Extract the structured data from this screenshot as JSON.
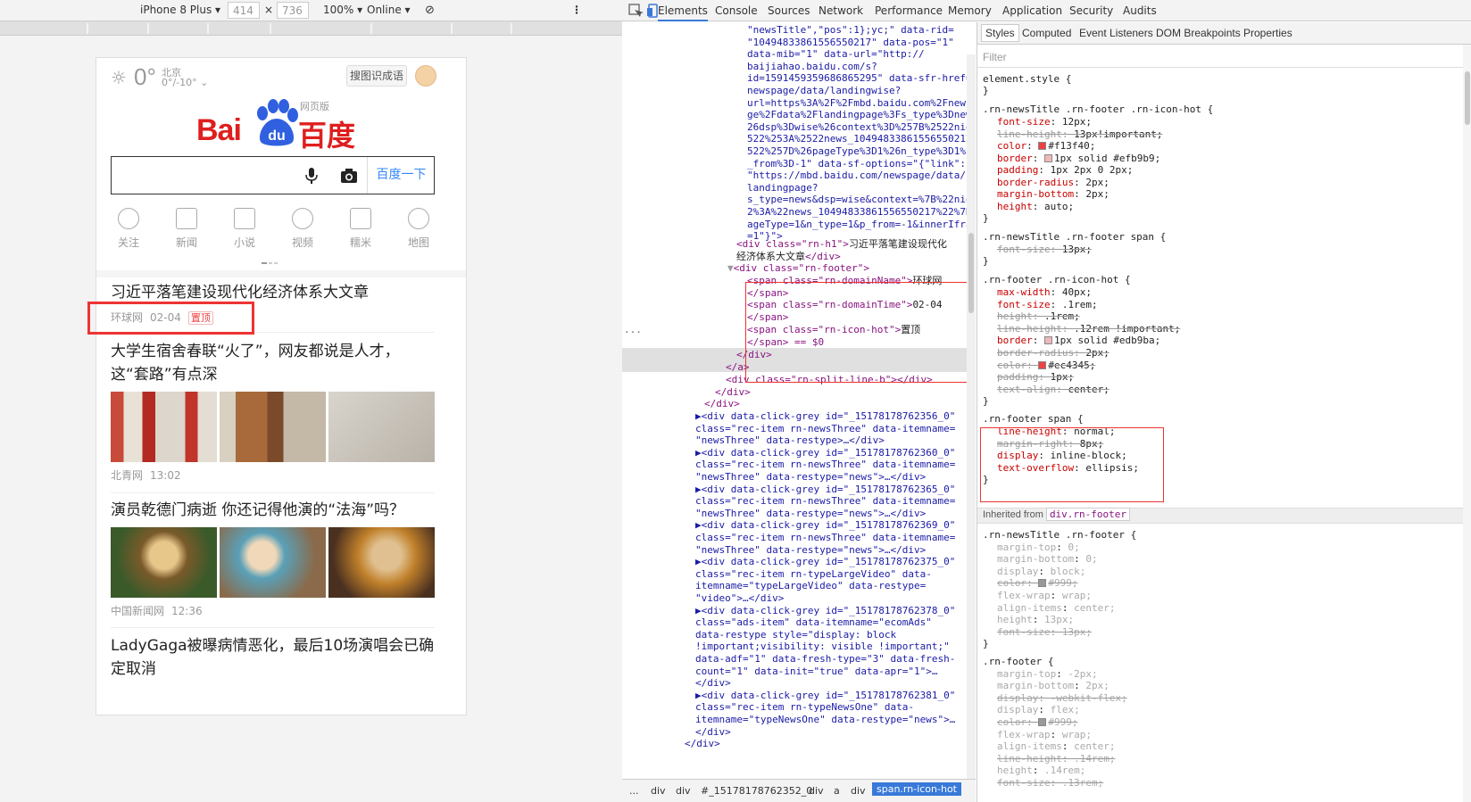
{
  "device": {
    "name": "iPhone 8 Plus",
    "width": "414",
    "height": "736",
    "times": "×",
    "zoom": "100%",
    "network": "Online"
  },
  "weather": {
    "temp": "0°",
    "city": "北京",
    "range": "0°/-10°"
  },
  "header": {
    "search_btn": "搜图识成语",
    "logo_text": "Bai",
    "logo_du": "du",
    "logo_cn": "百度",
    "logo_sub": "网页版",
    "search_button": "百度一下"
  },
  "nav": [
    "关注",
    "新闻",
    "小说",
    "视频",
    "糯米",
    "地图"
  ],
  "news": [
    {
      "title": "习近平落笔建设现代化经济体系大文章",
      "source": "环球网",
      "time": "02-04",
      "hot": "置顶"
    },
    {
      "title": "大学生宿舍春联“火了”，网友都说是人才，这“套路”有点深",
      "source": "北青网",
      "time": "13:02"
    },
    {
      "title": "演员乾德门病逝 你还记得他演的“法海”吗？",
      "source": "中国新闻网",
      "time": "12:36"
    },
    {
      "title": "LadyGaga被曝病情恶化，最后10场演唱会已确定取消"
    }
  ],
  "tabs": [
    "Elements",
    "Console",
    "Sources",
    "Network",
    "Performance",
    "Memory",
    "Application",
    "Security",
    "Audits"
  ],
  "elements": {
    "lines": [
      "\"newsTitle\",\"pos\":1};yc;\" data-rid=",
      "\"10494833861556550217\" data-pos=\"1\"",
      "data-mib=\"1\" data-url=\"http://",
      "baijiahao.baidu.com/s?",
      "id=1591459359686865295\" data-sfr-href=\"/",
      "newspage/data/landingwise?",
      "url=https%3A%2F%2Fmbd.baidu.com%2Fnewspa",
      "ge%2Fdata%2Flandingpage%3Fs_type%3Dnews%",
      "26dsp%3Dwise%26context%3D%257B%2522nid%2",
      "522%253A%2522news_10494833861556550217%2",
      "522%257D%26pageType%3D1%26n_type%3D1%26p",
      "_from%3D-1\" data-sf-options=\"{\"link\":",
      "\"https://mbd.baidu.com/newspage/data/",
      "landingpage?",
      "s_type=news&dsp=wise&context=%7B%22nid%2",
      "2%3A%22news_10494833861556550217%22%7D&p",
      "ageType=1&n_type=1&p_from=-1&innerIframe",
      "=1\"}\">"
    ],
    "h1": {
      "open": "<div class=\"rn-h1\">",
      "text": "习近平落笔建设现代化",
      "text2": "经济体系大文章",
      "close": "</div>"
    },
    "footer_open": "<div class=\"rn-footer\">",
    "span1_open": "<span class=\"rn-domainName\">",
    "span1_text": "环球网",
    "span2_open": "<span class=\"rn-domainTime\">",
    "span2_text": "02-04",
    "span3_open": "<span class=\"rn-icon-hot\">",
    "span3_text": "置顶",
    "span_close": "</span>",
    "span_sel": "</span> == $0",
    "div_close": "</div>",
    "a_close": "</a>",
    "split": "<div class=\"rn-split-line-b\"></div>",
    "rest": [
      "▶<div data-click-grey id=\"_15178178762356_0\"",
      "class=\"rec-item rn-newsThree\" data-itemname=",
      "\"newsThree\" data-restype>…</div>",
      "▶<div data-click-grey id=\"_15178178762360_0\"",
      "class=\"rec-item rn-newsThree\" data-itemname=",
      "\"newsThree\" data-restype=\"news\">…</div>",
      "▶<div data-click-grey id=\"_15178178762365_0\"",
      "class=\"rec-item rn-newsThree\" data-itemname=",
      "\"newsThree\" data-restype=\"news\">…</div>",
      "▶<div data-click-grey id=\"_15178178762369_0\"",
      "class=\"rec-item rn-newsThree\" data-itemname=",
      "\"newsThree\" data-restype=\"news\">…</div>",
      "▶<div data-click-grey id=\"_15178178762375_0\"",
      "class=\"rec-item rn-typeLargeVideo\" data-",
      "itemname=\"typeLargeVideo\" data-restype=",
      "\"video\">…</div>",
      "▶<div data-click-grey id=\"_15178178762378_0\"",
      "class=\"ads-item\" data-itemname=\"ecomAds\"",
      "data-restype style=\"display: block",
      "!important;visibility: visible !important;\"",
      "data-adf=\"1\" data-fresh-type=\"3\" data-fresh-",
      "count=\"1\" data-init=\"true\" data-apr=\"1\">…",
      "</div>",
      "▶<div data-click-grey id=\"_15178178762381_0\"",
      "class=\"rec-item rn-typeNewsOne\" data-",
      "itemname=\"typeNewsOne\" data-restype=\"news\">…",
      "</div>",
      "</div>"
    ]
  },
  "crumbs": [
    "...",
    "div",
    "div",
    "#_15178178762352_0",
    "div",
    "a",
    "div",
    "span.rn-icon-hot"
  ],
  "style_tabs": [
    "Styles",
    "Computed",
    "Event Listeners",
    "DOM Breakpoints",
    "Properties"
  ],
  "styles": {
    "filter": "Filter",
    "rules": [
      "element.style {",
      "}",
      ".rn-newsTitle .rn-footer .rn-icon-hot {",
      "font-size: 12px;",
      "line-height: 13px!important;",
      "color: #f13f40;",
      "border: 1px solid #efb9b9;",
      "padding: 1px 2px 0 2px;",
      "border-radius: 2px;",
      "margin-bottom: 2px;",
      "height: auto;",
      "}",
      ".rn-newsTitle .rn-footer span {",
      "font-size: 13px;",
      "}",
      ".rn-footer .rn-icon-hot {",
      "max-width: 40px;",
      "font-size: .1rem;",
      "height: .1rem;",
      "line-height: .12rem !important;",
      "border: 1px solid #edb9ba;",
      "border-radius: 2px;",
      "color: #ec4345;",
      "padding: 1px;",
      "text-align: center;",
      "}",
      ".rn-footer span {",
      "line-height: normal;",
      "margin-right: 8px;",
      "display: inline-block;",
      "text-overflow: ellipsis;",
      "}"
    ],
    "inherited_label": "Inherited from",
    "inherited_link": "div.rn-footer",
    "inh_rules": [
      ".rn-newsTitle .rn-footer {",
      "margin-top: 0;",
      "margin-bottom: 0;",
      "display: block;",
      "color: #999;",
      "flex-wrap: wrap;",
      "align-items: center;",
      "height: 13px;",
      "font-size: 13px;",
      "}",
      ".rn-footer {",
      "margin-top: -2px;",
      "margin-bottom: 2px;",
      "display: -webkit-flex;",
      "display: flex;",
      "color: #999;",
      "flex-wrap: wrap;",
      "align-items: center;",
      "line-height: .14rem;",
      "height: .14rem;",
      "font-size: .13rem;"
    ]
  }
}
